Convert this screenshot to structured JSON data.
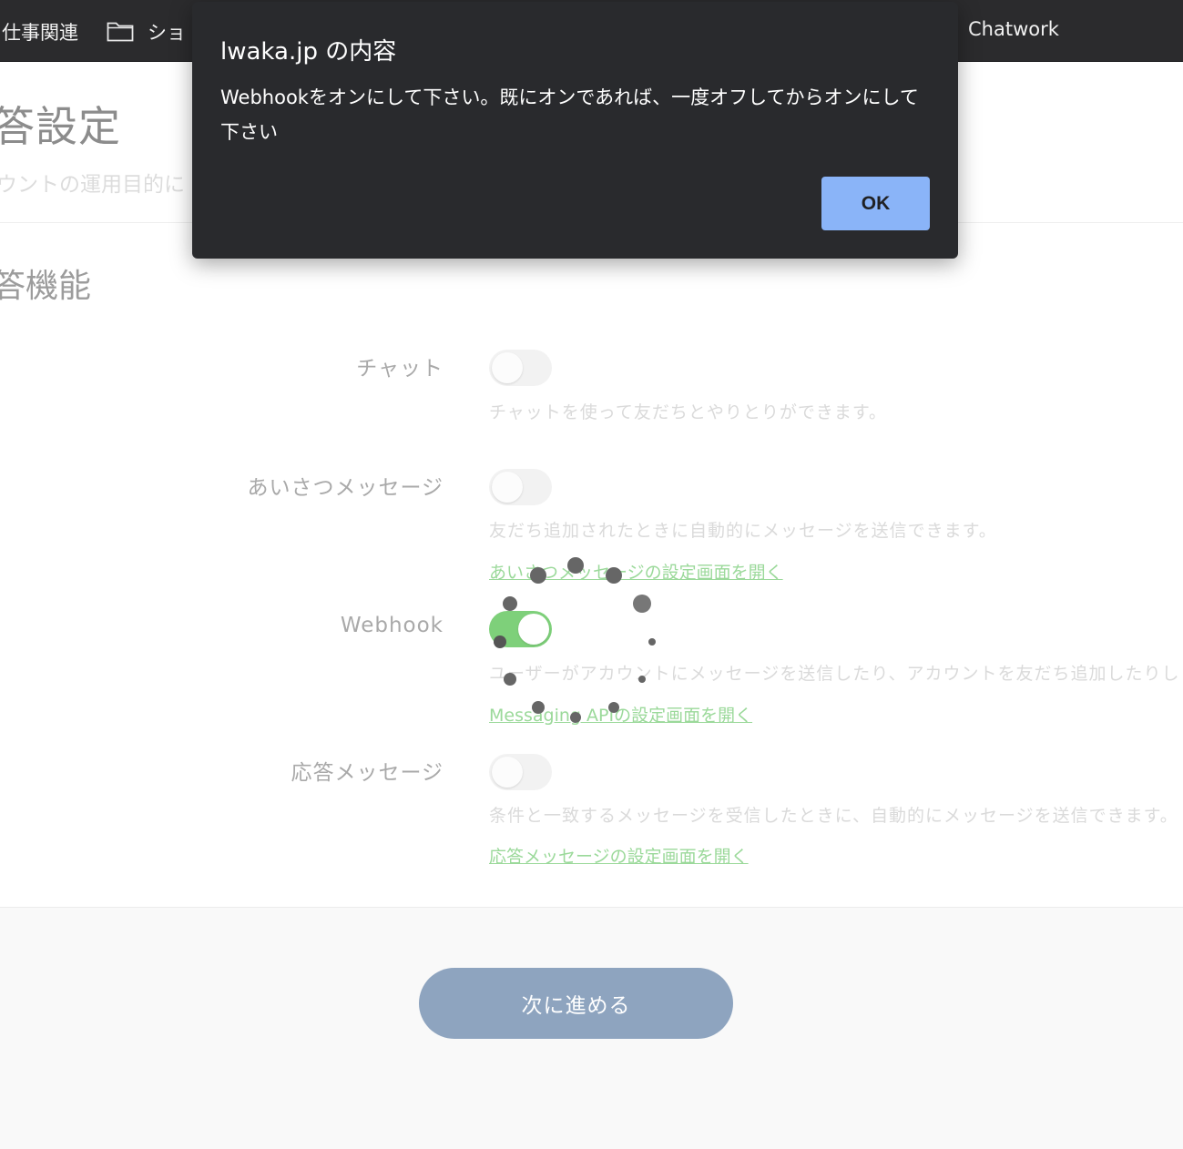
{
  "bookmarks": {
    "items": [
      {
        "label": "仕事関連"
      },
      {
        "label": "ショ"
      },
      {
        "label": "Chatwork"
      }
    ]
  },
  "page": {
    "title": "答設定",
    "subtitle": "ウントの運用目的に",
    "section_title": "答機能",
    "rows": [
      {
        "label": "チャット",
        "toggle_on": false,
        "description": "チャットを使って友だちとやりとりができます。",
        "link": ""
      },
      {
        "label": "あいさつメッセージ",
        "toggle_on": false,
        "description": "友だち追加されたときに自動的にメッセージを送信できます。",
        "link": "あいさつメッセージの設定画面を開く"
      },
      {
        "label": "Webhook",
        "toggle_on": true,
        "description": "ユーザーがアカウントにメッセージを送信したり、アカウントを友だち追加したりし",
        "link": "Messaging APIの設定画面を開く"
      },
      {
        "label": "応答メッセージ",
        "toggle_on": false,
        "description": "条件と一致するメッセージを受信したときに、自動的にメッセージを送信できます。",
        "link": "応答メッセージの設定画面を開く"
      }
    ],
    "next_button": "次に進める"
  },
  "dialog": {
    "title": "lwaka.jp の内容",
    "message": "Webhookをオンにして下さい。既にオンであれば、一度オフしてからオンにして下さい",
    "ok_label": "OK"
  },
  "colors": {
    "bookmarks_bg": "#2b2b2d",
    "dialog_bg": "#292a2d",
    "dialog_button": "#8ab4f8",
    "toggle_on": "#7ed07a",
    "link": "#9bd99a",
    "next_button": "#8ea4bf"
  }
}
